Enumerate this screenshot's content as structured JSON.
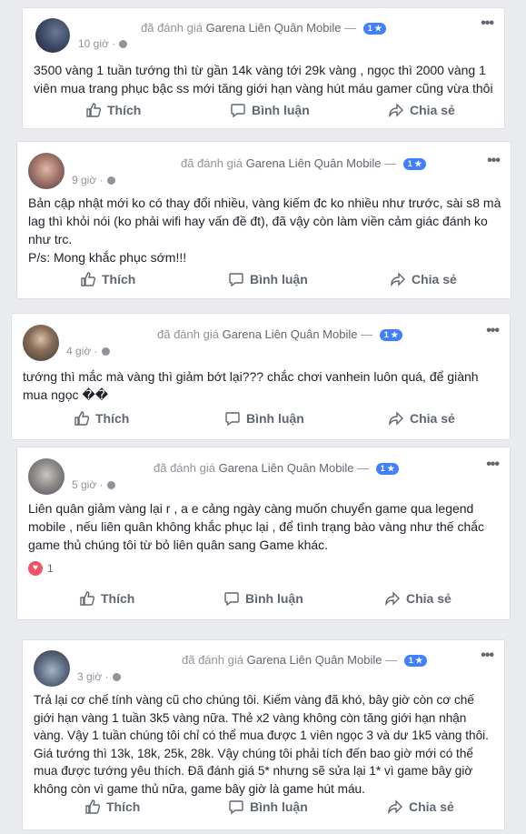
{
  "page_name": "Garena Liên Quân Mobile",
  "rated_text": "đã đánh giá",
  "dash": "—",
  "actions": {
    "like": "Thích",
    "comment": "Bình luận",
    "share": "Chia sẻ"
  },
  "more": "•••",
  "posts": [
    {
      "rating": "1 ★",
      "time": "10 giờ ·",
      "lines": [
        "3500 vàng 1 tuần tướng thì từ gần 14k vàng tới 29k vàng , ngọc thì 2000 vàng 1",
        "viên mua trang phục bậc ss mới tăng giới hạn vàng hút máu gamer cũng vừa thôi"
      ]
    },
    {
      "rating": "1 ★",
      "time": "9 giờ ·",
      "lines": [
        "Bản cập nhật mới ko có thay đổi nhiều, vàng kiếm đc ko nhiều như trước, sài s8 mà",
        "lag thì khỏi nói (ko phải wifi hay vấn đề đt), đã vậy còn làm viền cảm giác đánh ko",
        "như trc.",
        "P/s: Mong khắc phục sớm!!!"
      ]
    },
    {
      "rating": "1 ★",
      "time": "4 giờ ·",
      "lines": [
        "tướng thì mắc mà vàng thì giảm bớt lại??? chắc chơi vanhein luôn quá, để giành",
        "mua ngọc ��"
      ]
    },
    {
      "rating": "1 ★",
      "time": "5 giờ ·",
      "lines": [
        "Liên quân giảm vàng lại r , a e cảng ngày càng muốn chuyển game qua legend",
        "mobile , nếu liên quân không khắc phục lại , để tình trạng bào vàng như thế chắc",
        "game thủ chúng tôi từ bỏ liên quân sang Game khác."
      ],
      "reaction_count": "1"
    },
    {
      "rating": "1 ★",
      "time": "3 giờ ·",
      "lines": [
        "Trả lại cơ chế tính vàng cũ cho chúng tôi. Kiếm vàng đã khó, bây giờ còn cơ chế",
        "giới hạn vàng 1 tuần 3k5 vàng nữa. Thẻ x2 vàng không còn tăng giới hạn nhận",
        "vàng. Vậy 1 tuần chúng tôi chỉ có thể mua được 1 viên ngọc 3 và dư 1k5 vàng thôi.",
        "Giá tướng thì 13k, 18k, 25k, 28k. Vậy chúng tôi phải tích đến bao giờ mới có thể",
        "mua được tướng yêu thích. Đã đánh giá 5* nhưng sẽ sửa lại 1* vì game bây giờ",
        "không còn vì game thủ nữa, game bây giờ là game hút máu."
      ]
    }
  ],
  "colors": {
    "badge": "#4080ff",
    "heart": "#f25268",
    "bg": "#e9ebee"
  }
}
